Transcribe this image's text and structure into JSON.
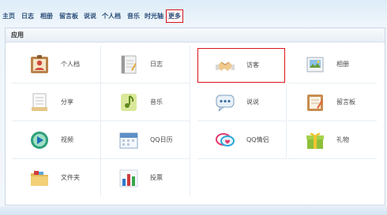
{
  "nav": {
    "items": [
      {
        "label": "主页"
      },
      {
        "label": "日志"
      },
      {
        "label": "相册"
      },
      {
        "label": "留言板"
      },
      {
        "label": "说说"
      },
      {
        "label": "个人档"
      },
      {
        "label": "音乐"
      },
      {
        "label": "时光轴"
      },
      {
        "label": "更多",
        "active": true
      }
    ]
  },
  "panel": {
    "title": "应用",
    "apps": [
      {
        "label": "个人档",
        "icon": "profile-card-icon"
      },
      {
        "label": "日志",
        "icon": "notebook-icon"
      },
      {
        "label": "访客",
        "icon": "handshake-icon",
        "highlighted": true
      },
      {
        "label": "相册",
        "icon": "photo-album-icon"
      },
      {
        "label": "分享",
        "icon": "document-share-icon"
      },
      {
        "label": "音乐",
        "icon": "music-note-icon"
      },
      {
        "label": "说说",
        "icon": "speech-bubble-icon"
      },
      {
        "label": "留言板",
        "icon": "message-board-icon"
      },
      {
        "label": "视频",
        "icon": "play-video-icon"
      },
      {
        "label": "QQ日历",
        "icon": "calendar-icon"
      },
      {
        "label": "QQ情侣",
        "icon": "couple-chat-icon"
      },
      {
        "label": "礼物",
        "icon": "gift-box-icon"
      },
      {
        "label": "文件夹",
        "icon": "folder-icon"
      },
      {
        "label": "投票",
        "icon": "bar-chart-vote-icon"
      }
    ]
  },
  "colors": {
    "nav_text": "#2b4f7a",
    "highlight_border": "#d8151c",
    "panel_border": "#c9d7e5"
  }
}
